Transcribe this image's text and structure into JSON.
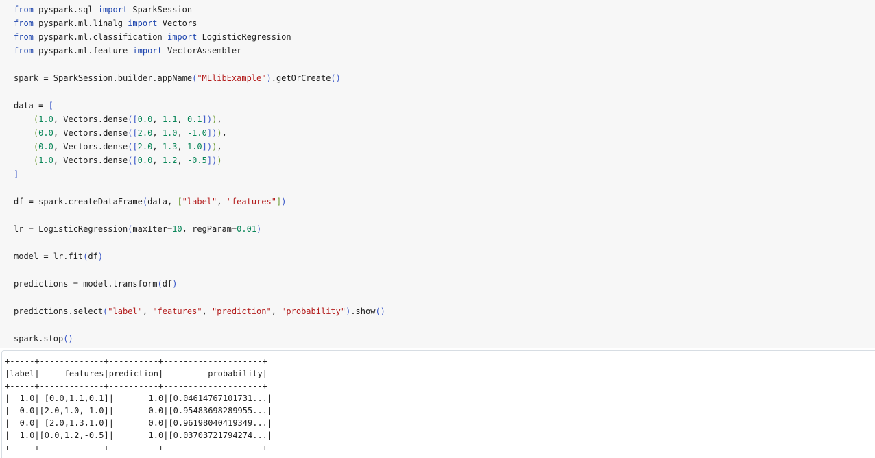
{
  "code_cell": {
    "lines": [
      [
        {
          "t": "from",
          "c": "kw"
        },
        {
          "t": " pyspark.sql "
        },
        {
          "t": "import",
          "c": "kw"
        },
        {
          "t": " SparkSession"
        }
      ],
      [
        {
          "t": "from",
          "c": "kw"
        },
        {
          "t": " pyspark.ml.linalg "
        },
        {
          "t": "import",
          "c": "kw"
        },
        {
          "t": " Vectors"
        }
      ],
      [
        {
          "t": "from",
          "c": "kw"
        },
        {
          "t": " pyspark.ml.classification "
        },
        {
          "t": "import",
          "c": "kw"
        },
        {
          "t": " LogisticRegression"
        }
      ],
      [
        {
          "t": "from",
          "c": "kw"
        },
        {
          "t": " pyspark.ml.feature "
        },
        {
          "t": "import",
          "c": "kw"
        },
        {
          "t": " VectorAssembler"
        }
      ],
      [],
      [
        {
          "t": "spark = SparkSession.builder.appName"
        },
        {
          "t": "(",
          "c": "b1"
        },
        {
          "t": "\"MLlibExample\"",
          "c": "str"
        },
        {
          "t": ")",
          "c": "b1"
        },
        {
          "t": ".getOrCreate"
        },
        {
          "t": "()",
          "c": "b1"
        }
      ],
      [],
      [
        {
          "t": "data = "
        },
        {
          "t": "[",
          "c": "b1"
        }
      ],
      [
        {
          "t": "    "
        },
        {
          "t": "(",
          "c": "b2"
        },
        {
          "t": "1.0",
          "c": "num"
        },
        {
          "t": ", Vectors.dense"
        },
        {
          "t": "(",
          "c": "b3"
        },
        {
          "t": "[",
          "c": "b1"
        },
        {
          "t": "0.0",
          "c": "num"
        },
        {
          "t": ", "
        },
        {
          "t": "1.1",
          "c": "num"
        },
        {
          "t": ", "
        },
        {
          "t": "0.1",
          "c": "num"
        },
        {
          "t": "]",
          "c": "b1"
        },
        {
          "t": ")",
          "c": "b3"
        },
        {
          "t": ")",
          "c": "b2"
        },
        {
          "t": ","
        }
      ],
      [
        {
          "t": "    "
        },
        {
          "t": "(",
          "c": "b2"
        },
        {
          "t": "0.0",
          "c": "num"
        },
        {
          "t": ", Vectors.dense"
        },
        {
          "t": "(",
          "c": "b3"
        },
        {
          "t": "[",
          "c": "b1"
        },
        {
          "t": "2.0",
          "c": "num"
        },
        {
          "t": ", "
        },
        {
          "t": "1.0",
          "c": "num"
        },
        {
          "t": ", "
        },
        {
          "t": "-1.0",
          "c": "num"
        },
        {
          "t": "]",
          "c": "b1"
        },
        {
          "t": ")",
          "c": "b3"
        },
        {
          "t": ")",
          "c": "b2"
        },
        {
          "t": ","
        }
      ],
      [
        {
          "t": "    "
        },
        {
          "t": "(",
          "c": "b2"
        },
        {
          "t": "0.0",
          "c": "num"
        },
        {
          "t": ", Vectors.dense"
        },
        {
          "t": "(",
          "c": "b3"
        },
        {
          "t": "[",
          "c": "b1"
        },
        {
          "t": "2.0",
          "c": "num"
        },
        {
          "t": ", "
        },
        {
          "t": "1.3",
          "c": "num"
        },
        {
          "t": ", "
        },
        {
          "t": "1.0",
          "c": "num"
        },
        {
          "t": "]",
          "c": "b1"
        },
        {
          "t": ")",
          "c": "b3"
        },
        {
          "t": ")",
          "c": "b2"
        },
        {
          "t": ","
        }
      ],
      [
        {
          "t": "    "
        },
        {
          "t": "(",
          "c": "b2"
        },
        {
          "t": "1.0",
          "c": "num"
        },
        {
          "t": ", Vectors.dense"
        },
        {
          "t": "(",
          "c": "b3"
        },
        {
          "t": "[",
          "c": "b1"
        },
        {
          "t": "0.0",
          "c": "num"
        },
        {
          "t": ", "
        },
        {
          "t": "1.2",
          "c": "num"
        },
        {
          "t": ", "
        },
        {
          "t": "-0.5",
          "c": "num"
        },
        {
          "t": "]",
          "c": "b1"
        },
        {
          "t": ")",
          "c": "b3"
        },
        {
          "t": ")",
          "c": "b2"
        }
      ],
      [
        {
          "t": "]",
          "c": "b1"
        }
      ],
      [],
      [
        {
          "t": "df = spark.createDataFrame"
        },
        {
          "t": "(",
          "c": "b1"
        },
        {
          "t": "data, "
        },
        {
          "t": "[",
          "c": "b2"
        },
        {
          "t": "\"label\"",
          "c": "str"
        },
        {
          "t": ", "
        },
        {
          "t": "\"features\"",
          "c": "str"
        },
        {
          "t": "]",
          "c": "b2"
        },
        {
          "t": ")",
          "c": "b1"
        }
      ],
      [],
      [
        {
          "t": "lr = LogisticRegression"
        },
        {
          "t": "(",
          "c": "b1"
        },
        {
          "t": "maxIter="
        },
        {
          "t": "10",
          "c": "num"
        },
        {
          "t": ", regParam="
        },
        {
          "t": "0.01",
          "c": "num"
        },
        {
          "t": ")",
          "c": "b1"
        }
      ],
      [],
      [
        {
          "t": "model = lr.fit"
        },
        {
          "t": "(",
          "c": "b1"
        },
        {
          "t": "df"
        },
        {
          "t": ")",
          "c": "b1"
        }
      ],
      [],
      [
        {
          "t": "predictions = model.transform"
        },
        {
          "t": "(",
          "c": "b1"
        },
        {
          "t": "df"
        },
        {
          "t": ")",
          "c": "b1"
        }
      ],
      [],
      [
        {
          "t": "predictions.select"
        },
        {
          "t": "(",
          "c": "b1"
        },
        {
          "t": "\"label\"",
          "c": "str"
        },
        {
          "t": ", "
        },
        {
          "t": "\"features\"",
          "c": "str"
        },
        {
          "t": ", "
        },
        {
          "t": "\"prediction\"",
          "c": "str"
        },
        {
          "t": ", "
        },
        {
          "t": "\"probability\"",
          "c": "str"
        },
        {
          "t": ")",
          "c": "b1"
        },
        {
          "t": ".show"
        },
        {
          "t": "()",
          "c": "b1"
        }
      ],
      [],
      [
        {
          "t": "spark.stop"
        },
        {
          "t": "()",
          "c": "b1"
        }
      ]
    ]
  },
  "output": {
    "lines": [
      "+-----+-------------+----------+--------------------+",
      "|label|     features|prediction|         probability|",
      "+-----+-------------+----------+--------------------+",
      "|  1.0| [0.0,1.1,0.1]|       1.0|[0.04614767101731...|",
      "|  0.0|[2.0,1.0,-1.0]|       0.0|[0.95483698289955...|",
      "|  0.0| [2.0,1.3,1.0]|       0.0|[0.96198040419349...|",
      "|  1.0|[0.0,1.2,-0.5]|       1.0|[0.03703721794274...|",
      "+-----+-------------+----------+--------------------+"
    ]
  },
  "colors": {
    "keyword": "#1d44ad",
    "string": "#b31b1b",
    "number": "#098658",
    "bracket_primary": "#3a58c8",
    "bracket_secondary": "#6b9a33",
    "code_background": "#f7f7f7",
    "output_background": "#ffffff"
  }
}
